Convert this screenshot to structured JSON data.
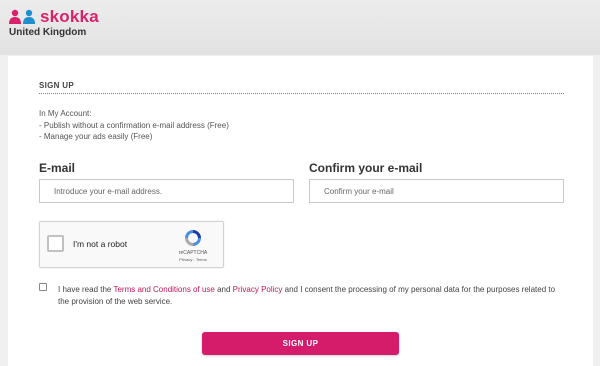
{
  "brand": {
    "name": "skokka",
    "region": "United Kingdom",
    "colors": {
      "accent": "#d8236b",
      "icon_secondary": "#1e8fcf"
    }
  },
  "form": {
    "section_title": "SIGN UP",
    "info_lines": [
      "In My Account:",
      "- Publish without a confirmation e-mail address (Free)",
      "- Manage your ads easily (Free)"
    ],
    "email": {
      "label": "E-mail",
      "placeholder": "Introduce your e-mail address.",
      "value": ""
    },
    "confirm_email": {
      "label": "Confirm your e-mail",
      "placeholder": "Confirm your e-mail",
      "value": ""
    },
    "captcha": {
      "label": "I'm not a robot",
      "brand": "reCAPTCHA",
      "links": "Privacy - Terms",
      "checked": false
    },
    "consent": {
      "checked": false,
      "text_before": "I have read the ",
      "terms_link": "Terms and Conditions of use",
      "text_middle": " and ",
      "privacy_link": "Privacy Policy",
      "text_after": " and I consent the processing of my personal data for the purposes related to the provision of the web service."
    },
    "submit_label": "SIGN UP"
  }
}
